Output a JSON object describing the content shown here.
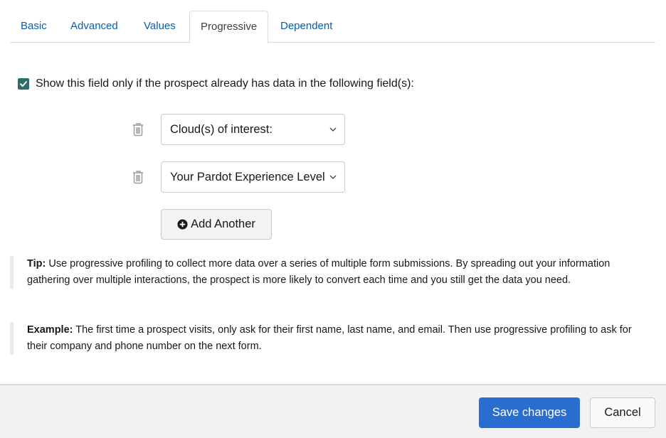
{
  "tabs": [
    {
      "label": "Basic",
      "active": false
    },
    {
      "label": "Advanced",
      "active": false
    },
    {
      "label": "Values",
      "active": false
    },
    {
      "label": "Progressive",
      "active": true
    },
    {
      "label": "Dependent",
      "active": false
    }
  ],
  "progressive": {
    "checkbox_checked": true,
    "checkbox_label": "Show this field only if the prospect already has data in the following field(s):",
    "fields": [
      {
        "value": "Cloud(s) of interest:",
        "icon": "trash-icon"
      },
      {
        "value": "Your Pardot Experience Level",
        "icon": "trash-icon"
      }
    ],
    "add_button_label": "Add Another"
  },
  "tip": {
    "label": "Tip:",
    "text": " Use progressive profiling to collect more data over a series of multiple form submissions. By spreading out your information gathering over multiple interactions, the prospect is more likely to convert each time and you still get the data you need."
  },
  "example": {
    "label": "Example:",
    "text": " The first time a prospect visits, only ask for their first name, last name, and email. Then use progressive profiling to ask for their company and phone number on the next form."
  },
  "footer": {
    "save_label": "Save changes",
    "cancel_label": "Cancel"
  },
  "colors": {
    "link": "#0b5cab",
    "brand": "#2a6dd0",
    "checkbox": "#2e6b70"
  }
}
